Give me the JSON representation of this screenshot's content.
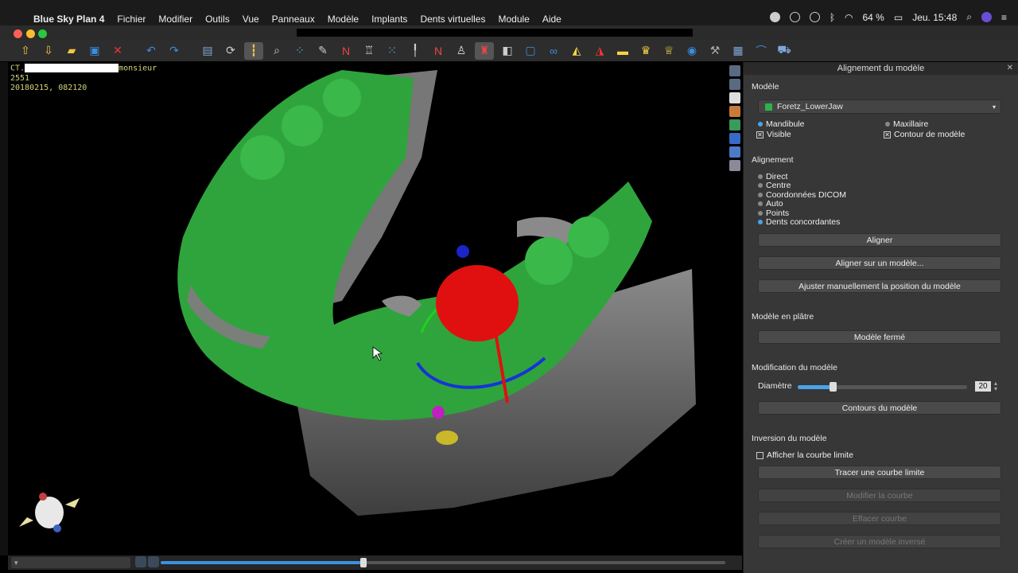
{
  "menubar": {
    "app_name": "Blue Sky Plan 4",
    "items": [
      "Fichier",
      "Modifier",
      "Outils",
      "Vue",
      "Panneaux",
      "Modèle",
      "Implants",
      "Dents virtuelles",
      "Module",
      "Aide"
    ],
    "battery": "64 %",
    "clock": "Jeu. 15:48"
  },
  "viewport": {
    "patient_line1_prefix": "CT.",
    "patient_line1_suffix": "monsieur",
    "patient_line2": "2551",
    "patient_line3": "20180215, 082120"
  },
  "panel": {
    "title": "Alignement du modèle",
    "model_section": "Modèle",
    "model_name": "Foretz_LowerJaw",
    "model_color": "#2db34a",
    "mandibule": "Mandibule",
    "maxillaire": "Maxillaire",
    "visible": "Visible",
    "contour": "Contour de modèle",
    "alignment_section": "Alignement",
    "alignment_options": [
      "Direct",
      "Centre",
      "Coordonnées DICOM",
      "Auto",
      "Points",
      "Dents concordantes"
    ],
    "btn_align": "Aligner",
    "btn_align_model": "Aligner sur un modèle...",
    "btn_manual": "Ajuster manuellement la position du modèle",
    "plaster_section": "Modèle en plâtre",
    "btn_closed": "Modèle fermé",
    "modification_section": "Modification du modèle",
    "diameter_label": "Diamètre",
    "diameter_value": "20",
    "btn_contours": "Contours du modèle",
    "inversion_section": "Inversion du modèle",
    "show_curve": "Afficher la courbe limite",
    "btn_trace": "Tracer une courbe limite",
    "btn_modify": "Modifier la courbe",
    "btn_erase": "Effacer courbe",
    "btn_create": "Créer un modèle inversé"
  }
}
